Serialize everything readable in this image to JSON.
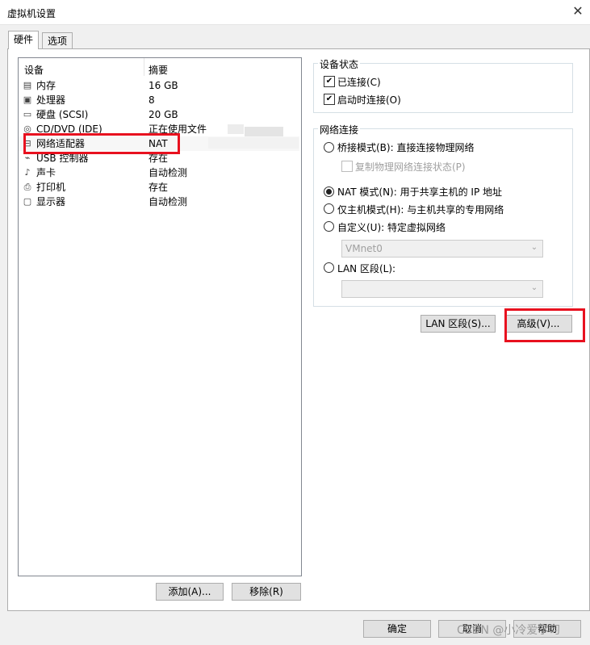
{
  "window": {
    "title": "虚拟机设置",
    "close_glyph": "✕"
  },
  "tabs": [
    {
      "label": "硬件"
    },
    {
      "label": "选项"
    }
  ],
  "device_list": {
    "header_device": "设备",
    "header_summary": "摘要",
    "rows": [
      {
        "icon": "memory-icon",
        "glyph": "▤",
        "name": "内存",
        "summary": "16 GB"
      },
      {
        "icon": "processor-icon",
        "glyph": "▣",
        "name": "处理器",
        "summary": "8"
      },
      {
        "icon": "hard-disk-icon",
        "glyph": "▭",
        "name": "硬盘 (SCSI)",
        "summary": "20 GB"
      },
      {
        "icon": "cd-dvd-icon",
        "glyph": "◎",
        "name": "CD/DVD (IDE)",
        "summary": "正在使用文件"
      },
      {
        "icon": "network-adapter-icon",
        "glyph": "⊟",
        "name": "网络适配器",
        "summary": "NAT"
      },
      {
        "icon": "usb-controller-icon",
        "glyph": "⌁",
        "name": "USB 控制器",
        "summary": "存在"
      },
      {
        "icon": "sound-card-icon",
        "glyph": "♪",
        "name": "声卡",
        "summary": "自动检测"
      },
      {
        "icon": "printer-icon",
        "glyph": "⎙",
        "name": "打印机",
        "summary": "存在"
      },
      {
        "icon": "display-icon",
        "glyph": "▢",
        "name": "显示器",
        "summary": "自动检测"
      }
    ],
    "add_button": "添加(A)...",
    "remove_button": "移除(R)"
  },
  "device_status": {
    "title": "设备状态",
    "connected": {
      "label": "已连接(C)",
      "checked": true
    },
    "connect_at_power_on": {
      "label": "启动时连接(O)",
      "checked": true
    }
  },
  "network_connection": {
    "title": "网络连接",
    "bridged": {
      "label": "桥接模式(B): 直接连接物理网络",
      "selected": false
    },
    "replicate": {
      "label": "复制物理网络连接状态(P)",
      "checked": false,
      "enabled": false
    },
    "nat": {
      "label": "NAT 模式(N): 用于共享主机的 IP 地址",
      "selected": true
    },
    "host_only": {
      "label": "仅主机模式(H): 与主机共享的专用网络",
      "selected": false
    },
    "custom": {
      "label": "自定义(U): 特定虚拟网络",
      "selected": false
    },
    "custom_combo_value": "VMnet0",
    "lan_segment": {
      "label": "LAN 区段(L):",
      "selected": false
    },
    "lan_combo_value": "",
    "combo_arrow": "⌄"
  },
  "buttons": {
    "lan_segments": "LAN 区段(S)...",
    "advanced": "高级(V)...",
    "ok": "确定",
    "cancel": "取消",
    "help": "帮助"
  },
  "watermark": "CSDN @小冷爱学习",
  "colors": {
    "highlight_box": "#e8111f",
    "panel_bg": "#f0f0f0"
  }
}
